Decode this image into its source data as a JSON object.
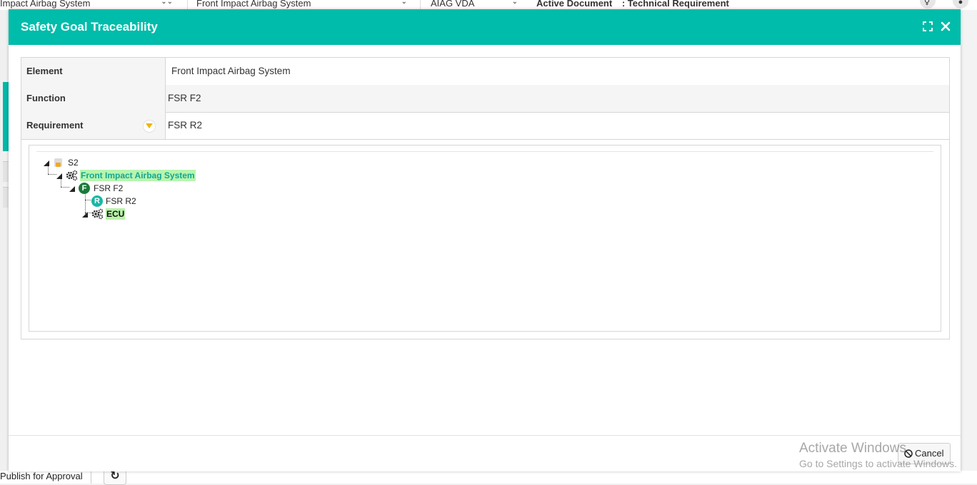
{
  "background": {
    "selectors": [
      {
        "value": "Impact Airbag System"
      },
      {
        "value": "Front Impact Airbag System"
      },
      {
        "value": "AIAG VDA"
      }
    ],
    "active_document_label": "Active Document",
    "active_document_value": ": Technical Requirement",
    "publish_label": "Publish for Approval"
  },
  "modal": {
    "title": "Safety Goal Traceability",
    "maximize_icon": "maximize-icon",
    "close_icon": "close-icon",
    "fields": [
      {
        "label": "Element",
        "value": "Front Impact Airbag System"
      },
      {
        "label": "Function",
        "value": "FSR F2"
      },
      {
        "label": "Requirement",
        "value": "FSR R2"
      }
    ],
    "tree": {
      "root": {
        "label": "S2",
        "icon": "safety-goal-icon"
      },
      "element": {
        "label": "Front Impact Airbag System",
        "icon": "gears-icon"
      },
      "function": {
        "label": "FSR F2",
        "icon_letter": "F",
        "icon_color": "#1b7a3a"
      },
      "requirement": {
        "label": "FSR R2",
        "icon_letter": "R",
        "icon_color": "#17b8a6"
      },
      "component": {
        "label": "ECU",
        "icon": "gears-icon"
      }
    },
    "cancel_label": "Cancel"
  },
  "watermark": {
    "line1": "Activate Windows",
    "line2": "Go to Settings to activate Windows."
  },
  "colors": {
    "accent": "#00bcaa",
    "dropdown": "#f0b400"
  }
}
